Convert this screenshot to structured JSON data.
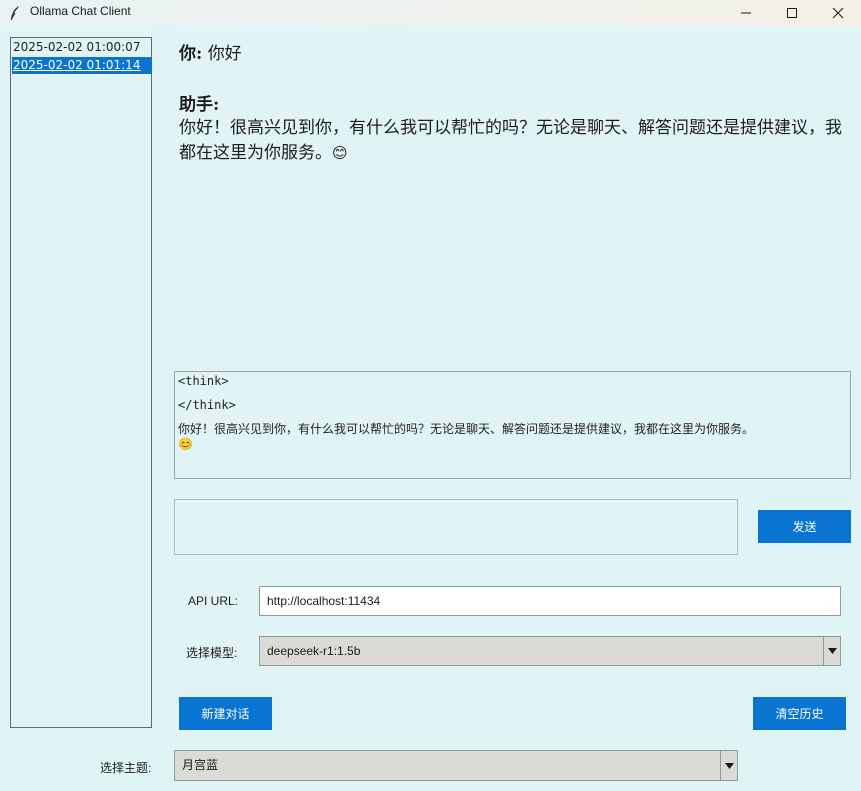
{
  "window": {
    "title": "Ollama Chat Client",
    "icon": "feather-icon",
    "controls": [
      "minimize-icon",
      "maximize-icon",
      "close-icon"
    ]
  },
  "history": {
    "items": [
      {
        "label": "2025-02-02 01:00:07",
        "selected": false
      },
      {
        "label": "2025-02-02 01:01:14",
        "selected": true
      }
    ],
    "selected_color": "#0a74d1"
  },
  "chat": {
    "user_label": "你:",
    "user_text": "你好",
    "assistant_label": "助手:",
    "assistant_text": "你好！很高兴见到你，有什么我可以帮忙的吗？无论是聊天、解答问题还是提供建议，我都在这里为你服务。",
    "assistant_emoji": "😊"
  },
  "raw_output": {
    "think_open": "<think>",
    "think_close": "</think>",
    "text": "你好！很高兴见到你，有什么我可以帮忙的吗？无论是聊天、解答问题还是提供建议，我都在这里为你服务。",
    "emoji": "😊"
  },
  "input": {
    "value": "",
    "send_label": "发送"
  },
  "settings": {
    "api_label": "API URL:",
    "api_value": "http://localhost:11434",
    "model_label": "选择模型:",
    "model_value": "deepseek-r1:1.5b",
    "theme_label": "选择主题:",
    "theme_value": "月宫蓝"
  },
  "actions": {
    "new_chat_label": "新建对话",
    "clear_history_label": "清空历史"
  },
  "colors": {
    "background": "#e0f4f6",
    "accent": "#0a74d1"
  }
}
